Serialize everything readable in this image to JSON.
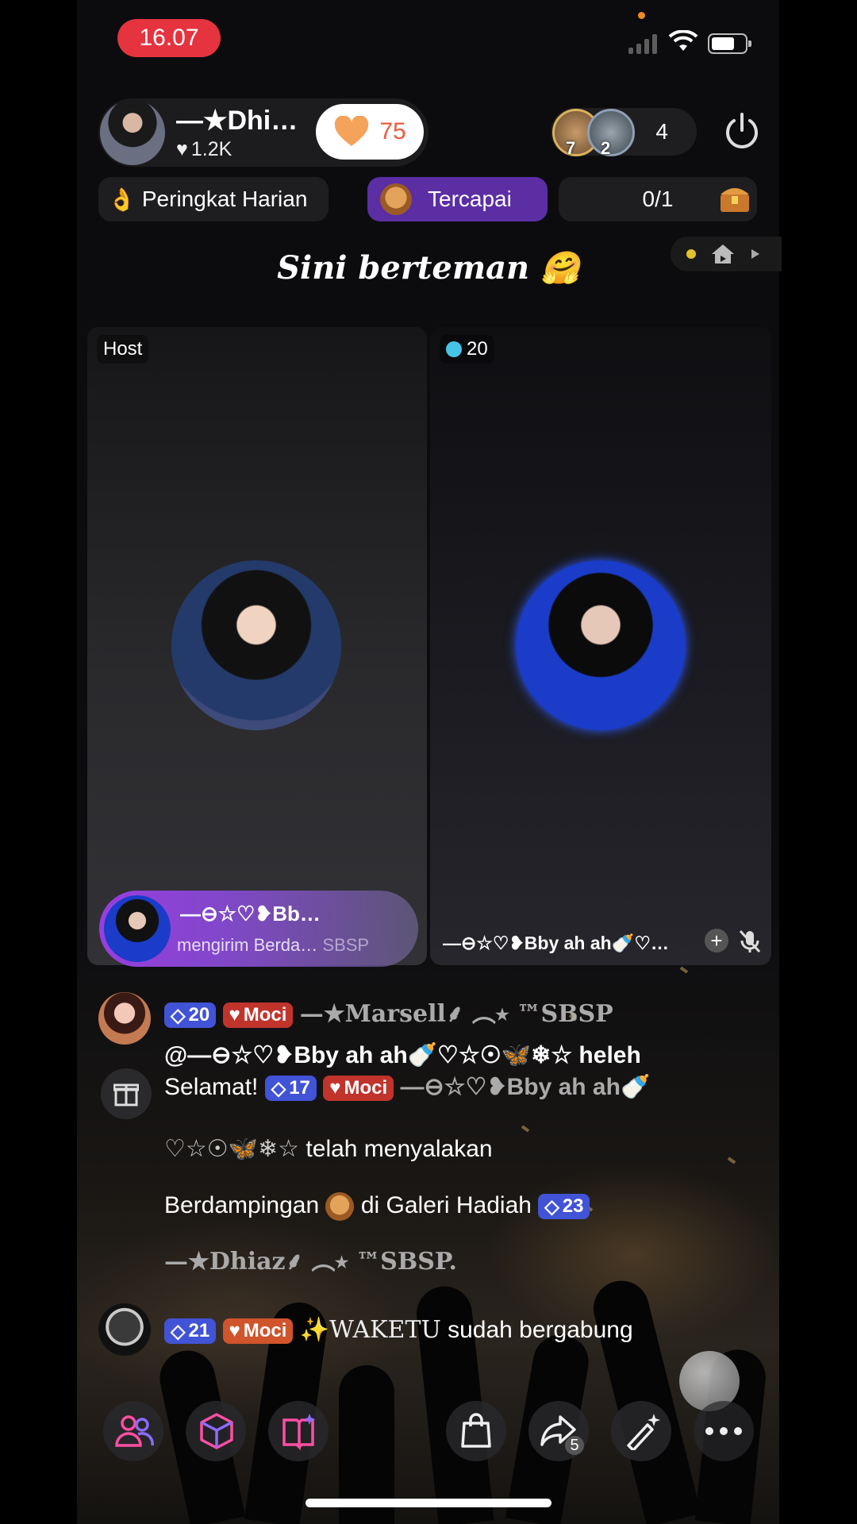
{
  "status_bar": {
    "time": "16.07"
  },
  "host": {
    "name": "—★Dhi…",
    "likes": "1.2K",
    "follow_count": "75"
  },
  "viewers": {
    "rank_a": "7",
    "rank_b": "2",
    "count": "4"
  },
  "chips": {
    "daily_rank": "Peringkat Harian",
    "achieved": "Tercapai",
    "progress": "0/1"
  },
  "room_title": "Sini berteman 🤗",
  "seats": {
    "host_label": "Host",
    "guest_badge": "20",
    "gift_banner_name": "—⊖☆♡❥Bb…",
    "gift_banner_sub": "mengirim Berda…",
    "gift_banner_ghost": "SBSP",
    "guest_name": "—⊖☆♡❥Bby ah ah🍼♡…"
  },
  "chat": [
    {
      "level": "20",
      "tag": "Moci",
      "name": "—★Marsell⸙ ︵⭑ ™SBSP"
    },
    {
      "mention": "@—⊖☆♡❥Bby ah ah🍼♡☆☉🦋❄☆ heleh"
    },
    {
      "prefix": "Selamat!",
      "level": "17",
      "tag": "Moci",
      "name": "—⊖☆♡❥Bby ah ah🍼",
      "line2_deco": "♡☆☉🦋❄☆",
      "line2_text": "telah menyalakan",
      "line3_text": "Berdampingan",
      "line3_suffix": "di Galeri Hadiah",
      "line3_level": "23",
      "line4": "—★Dhiaz⸙ ︵⭑ ™SBSP."
    },
    {
      "level": "21",
      "tag": "Moci",
      "name": "✨WAKETU",
      "text": "sudah bergabung"
    }
  ],
  "toolbar": {
    "share_count": "5"
  },
  "colors": {
    "accent": "#5b2ea4",
    "live_red": "#e5333f",
    "level_blue": "#4153d6",
    "tag_red": "#c0342c",
    "follow_orange": "#f05a3c"
  },
  "icons": [
    "users-icon",
    "cube-icon",
    "book-sparkle-icon",
    "shopping-bag-icon",
    "share-icon",
    "magic-wand-icon",
    "more-icon",
    "power-icon",
    "gift-icon",
    "mic-off-icon"
  ]
}
